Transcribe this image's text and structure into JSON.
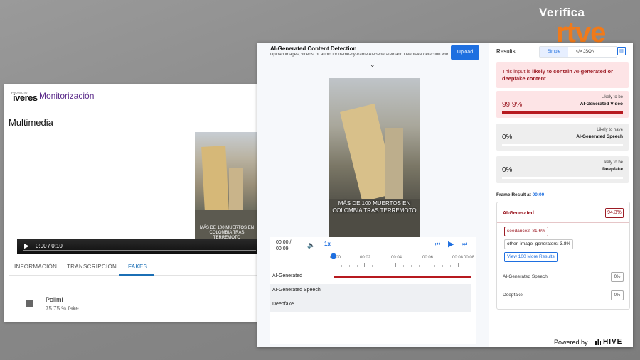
{
  "brand": {
    "verifica": "Verifica",
    "rtve": "rtve"
  },
  "left_window": {
    "logo_text": "iveres",
    "logo_prefix": "PROYECTO",
    "title": "Monitorización",
    "section": "Multimedia",
    "video": {
      "time": "0:00 / 0:10",
      "caption": "MÁS DE 100 MUERTOS EN COLOMBIA TRAS TERREMOTO"
    },
    "tabs": [
      {
        "label": "INFORMACIÓN"
      },
      {
        "label": "TRANSCRIPCIÓN"
      },
      {
        "label": "FAKES"
      }
    ],
    "result_row": {
      "name": "Polimi",
      "value": "75.75 % fake"
    }
  },
  "right_window": {
    "title": "AI-Generated Content Detection",
    "subtitle": "Upload images, videos, or audio for frame-by-frame AI-Generated and Deepfake detection with...",
    "upload_label": "Upload",
    "video_caption": "MÁS DE 100 MUERTOS EN COLOMBIA TRAS TERREMOTO",
    "player": {
      "time_current": "00:00 /",
      "time_total": "00:09",
      "speed": "1x",
      "ruler_labels": [
        "00:00",
        "00:02",
        "00:04",
        "00:06",
        "00:08",
        "00:08"
      ],
      "tracks": [
        "AI-Generated",
        "AI-Generated Speech",
        "Deepfake"
      ],
      "ai_generated_fraction": 1.0
    },
    "results": {
      "title": "Results",
      "simple_label": "Simple",
      "json_label": "</> JSON",
      "alert_prefix": "This input is ",
      "alert_bold": "likely to contain AI-generated or deepfake content",
      "cards": [
        {
          "value": "99.9%",
          "small": "Likely to be",
          "big": "AI-Generated Video",
          "fraction": 0.999
        },
        {
          "value": "0%",
          "small": "Likely to have",
          "big": "AI-Generated Speech",
          "fraction": 0
        },
        {
          "value": "0%",
          "small": "Likely to be",
          "big": "Deepfake",
          "fraction": 0
        }
      ],
      "frame_result_label": "Frame Result at ",
      "frame_time": "00:00",
      "frame": {
        "ai_label": "AI-Generated",
        "ai_value": "94.3%",
        "chips": [
          "seedance2: 81.6%",
          "other_image_generators: 3.8%"
        ],
        "more_button": "View 100 More Results",
        "speech_label": "AI-Generated Speech",
        "speech_value": "0%",
        "deepfake_label": "Deepfake",
        "deepfake_value": "0%"
      }
    },
    "powered_by": "Powered by",
    "hive": "HIVE"
  },
  "colors": {
    "accent": "#1e6fe0",
    "alert": "#9c1b24",
    "rtve": "#f07a1a"
  }
}
